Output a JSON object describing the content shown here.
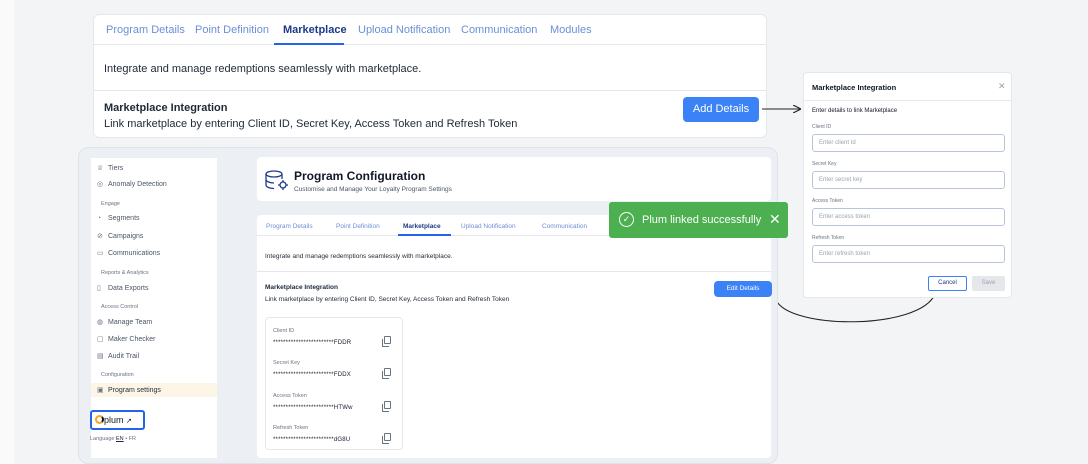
{
  "top_panel": {
    "tabs": [
      "Program Details",
      "Point Definition",
      "Marketplace",
      "Upload Notification",
      "Communication",
      "Modules"
    ],
    "active_tab": "Marketplace",
    "intro": "Integrate and manage redemptions seamlessly with marketplace.",
    "section_title": "Marketplace Integration",
    "section_subtitle": "Link marketplace by entering Client ID, Secret Key, Access Token and Refresh Token",
    "add_button": "Add Details"
  },
  "sidebar": {
    "items": [
      {
        "label": "Tiers",
        "icon": "trophy-icon"
      },
      {
        "label": "Anomaly Detection",
        "icon": "radar-icon"
      },
      {
        "group": "Engage"
      },
      {
        "label": "Segments",
        "icon": "segments-icon"
      },
      {
        "label": "Campaigns",
        "icon": "megaphone-icon"
      },
      {
        "label": "Communications",
        "icon": "chat-icon"
      },
      {
        "group": "Reports & Analytics"
      },
      {
        "label": "Data Exports",
        "icon": "file-icon"
      },
      {
        "group": "Access Control"
      },
      {
        "label": "Manage Team",
        "icon": "team-icon"
      },
      {
        "label": "Maker Checker",
        "icon": "checker-icon"
      },
      {
        "label": "Audit Trail",
        "icon": "audit-icon"
      },
      {
        "group": "Configuration"
      },
      {
        "label": "Program settings",
        "icon": "settings-icon",
        "selected": true
      }
    ],
    "brand": "plum",
    "brand_arrow": "↗",
    "language_label": "Language",
    "language_active": "EN",
    "language_separator": "•",
    "language_other": "FR"
  },
  "header": {
    "title": "Program Configuration",
    "subtitle": "Customise and Manage Your Loyalty Program Settings"
  },
  "inner": {
    "tabs": [
      "Program Details",
      "Point Definition",
      "Marketplace",
      "Upload Notification",
      "Communication"
    ],
    "active_tab": "Marketplace",
    "intro": "Integrate and manage redemptions seamlessly with marketplace.",
    "section_title": "Marketplace Integration",
    "section_subtitle": "Link marketplace by entering Client ID, Secret Key, Access Token and Refresh Token",
    "edit_button": "Edit Details",
    "credentials": [
      {
        "label": "Client ID",
        "value": "************************FDDR"
      },
      {
        "label": "Secret Key",
        "value": "************************FDDX"
      },
      {
        "label": "Access Token",
        "value": "************************HTWw"
      },
      {
        "label": "Refresh Token",
        "value": "************************dG8U"
      }
    ]
  },
  "toast": {
    "message": "Plum linked successfully",
    "check": "✓",
    "close": "✕",
    "color": "#4caf50"
  },
  "modal": {
    "title": "Marketplace Integration",
    "close": "✕",
    "description": "Enter details to link Marketplace",
    "fields": [
      {
        "label": "Client ID",
        "placeholder": "Enter client Id"
      },
      {
        "label": "Secret Key",
        "placeholder": "Enter secret key"
      },
      {
        "label": "Access Token",
        "placeholder": "Enter access token"
      },
      {
        "label": "Refresh Token",
        "placeholder": "Enter refresh token"
      }
    ],
    "cancel": "Cancel",
    "save": "Save"
  },
  "colors": {
    "accent": "#3b82f6",
    "active_tab": "#1e3a8a",
    "success": "#4caf50",
    "selected_nav": "#fdf6e6"
  }
}
